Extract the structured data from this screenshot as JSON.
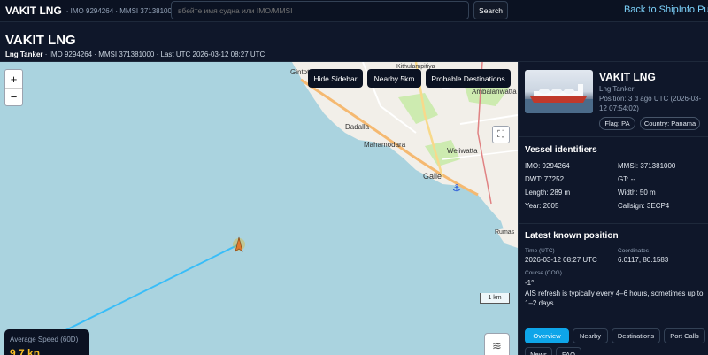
{
  "topbar": {
    "brand": "VAKIT LNG",
    "brand_sub": "· IMO 9294264 · MMSI 371381000",
    "search_placeholder": "вбейте имя судна или IMO/MMSI",
    "search_button": "Search",
    "back_link": "Back to ShipInfo Pul"
  },
  "header": {
    "title": "VAKIT LNG",
    "type": "Lng Tanker",
    "meta": " · IMO 9294264 · MMSI 371381000 · Last UTC 2026-03-12 08:27 UTC"
  },
  "map": {
    "zoom_in": "+",
    "zoom_out": "−",
    "buttons": {
      "hide_sidebar": "Hide Sidebar",
      "nearby": "Nearby 5km",
      "probable": "Probable Destinations"
    },
    "scale_label": "1 km",
    "speed_label": "Average Speed (60D)",
    "speed_value": "9.7 kn",
    "places": {
      "galle": "Galle",
      "dadalla": "Dadalla",
      "mahamodara": "Mahamodara",
      "weliwatta": "Weliwatta",
      "ambalanwatta": "Ambalanwatta",
      "kithulampitiya": "Kithulampitiya",
      "gintota": "Gintota",
      "rumas": "Rumas"
    },
    "colors": {
      "sea": "#aad3df",
      "land": "#f2efe9",
      "track": "#38bdf8",
      "vessel": "#e07a2e"
    }
  },
  "sidebar": {
    "vessel_name": "VAKIT LNG",
    "vessel_type": "Lng Tanker",
    "position_age": "Position: 3 d ago UTC (2026-03-12 07:54:02)",
    "flag_chip": "Flag: PA",
    "country_chip": "Country: Panama",
    "identifiers": {
      "title": "Vessel identifiers",
      "imo": "IMO: 9294264",
      "mmsi": "MMSI: 371381000",
      "dwt": "DWT: 77252",
      "gt": "GT: --",
      "length": "Length: 289 m",
      "width": "Width: 50 m",
      "year": "Year: 2005",
      "callsign": "Callsign: 3ECP4"
    },
    "position": {
      "title": "Latest known position",
      "time_label": "Time (UTC)",
      "time_value": "2026-03-12 08:27 UTC",
      "coords_label": "Coordinates",
      "coords_value": "6.0117, 80.1583",
      "course_label": "Course (COG)",
      "course_value": "-1°",
      "note": "AIS refresh is typically every 4–6 hours, sometimes up to 1–2 days."
    },
    "tabs": [
      "Overview",
      "Nearby",
      "Destinations",
      "Port Calls",
      "News",
      "FAQ"
    ]
  }
}
